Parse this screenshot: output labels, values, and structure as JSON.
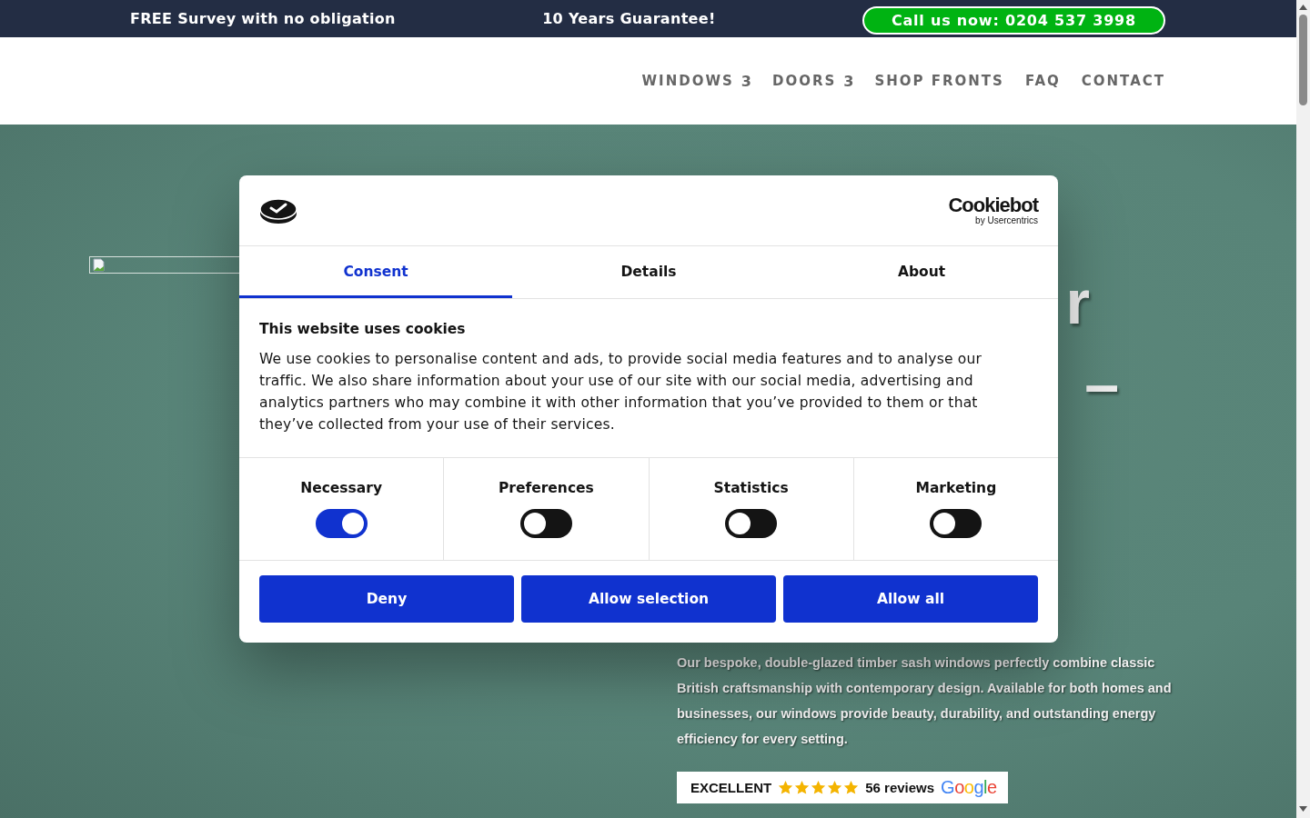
{
  "top_bar": {
    "survey": "FREE Survey with no obligation",
    "guarantee": "10 Years Guarantee!",
    "call_button": "Call us now: 0204 537 3998"
  },
  "nav": {
    "items": [
      {
        "label": "WINDOWS",
        "caret": "3"
      },
      {
        "label": "DOORS",
        "caret": "3"
      },
      {
        "label": "SHOP FRONTS"
      },
      {
        "label": "FAQ"
      },
      {
        "label": "CONTACT"
      }
    ]
  },
  "hero": {
    "heading_fragments": [
      "r",
      "–"
    ],
    "description": "Our bespoke, double-glazed timber sash windows perfectly combine classic British craftsmanship with contemporary design. Available for both homes and businesses, our windows provide beauty, durability, and outstanding energy efficiency for every setting.",
    "review_badge": {
      "rating": "EXCELLENT",
      "stars": 5,
      "count": "56 reviews",
      "brand": "Google"
    }
  },
  "cookie_dialog": {
    "brand": "Cookiebot",
    "brand_sub": "by Usercentrics",
    "tabs": [
      {
        "label": "Consent",
        "selected": true
      },
      {
        "label": "Details",
        "selected": false
      },
      {
        "label": "About",
        "selected": false
      }
    ],
    "title": "This website uses cookies",
    "text": "We use cookies to personalise content and ads, to provide social media features and to analyse our traffic. We also share information about your use of our site with our social media, advertising and analytics partners who may combine it with other information that you’ve provided to them or that they’ve collected from your use of their services.",
    "categories": [
      {
        "label": "Necessary",
        "on": true
      },
      {
        "label": "Preferences",
        "on": false
      },
      {
        "label": "Statistics",
        "on": false
      },
      {
        "label": "Marketing",
        "on": false
      }
    ],
    "buttons": [
      "Deny",
      "Allow selection",
      "Allow all"
    ]
  }
}
